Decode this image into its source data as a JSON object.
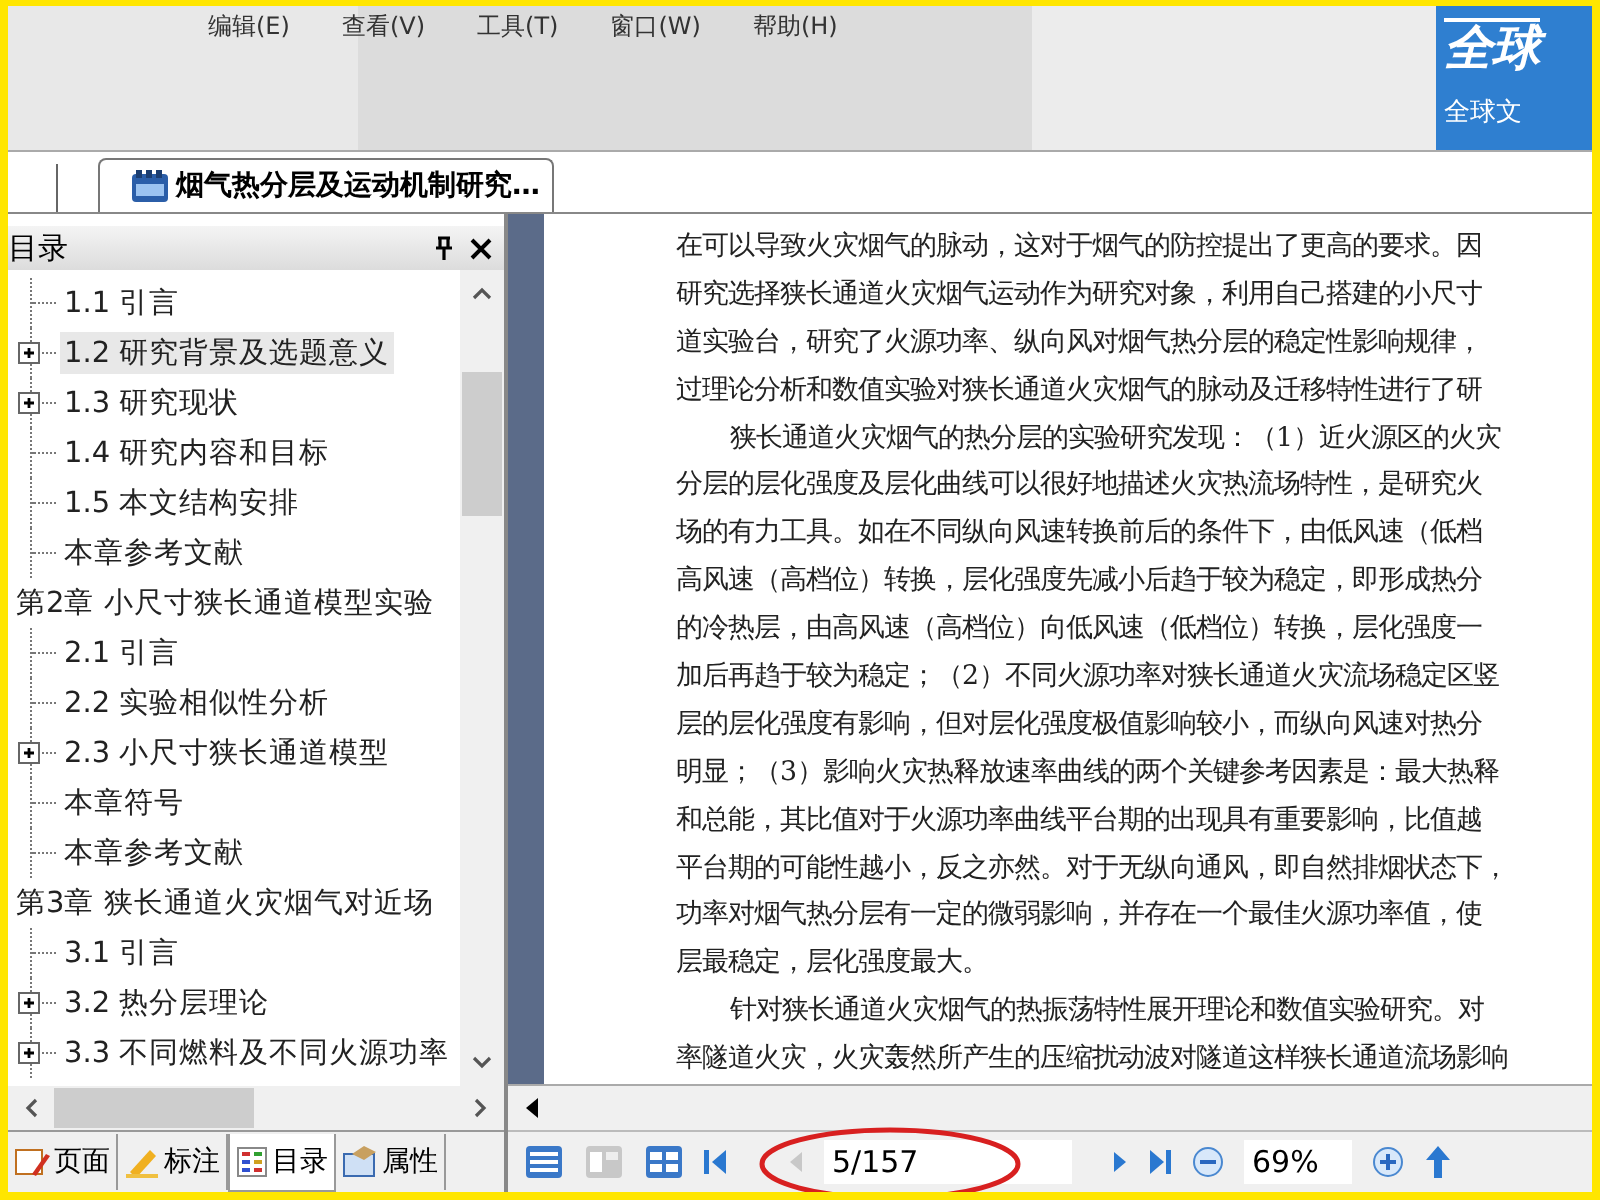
{
  "menu": [
    "编辑(E)",
    "查看(V)",
    "工具(T)",
    "窗口(W)",
    "帮助(H)"
  ],
  "ad": {
    "logo": "全球",
    "caption": "全球文"
  },
  "tabs": [
    {
      "label": "烟气热分层及运动机制研究…",
      "selected": true
    }
  ],
  "toc_panel": {
    "title": "目录",
    "continued_items": [
      {
        "label": "1.1 引言",
        "expandable": false,
        "selected": false
      },
      {
        "label": "1.2 研究背景及选题意义",
        "expandable": true,
        "selected": true
      },
      {
        "label": "1.3 研究现状",
        "expandable": true,
        "selected": false
      },
      {
        "label": "1.4 研究内容和目标",
        "expandable": false,
        "selected": false
      },
      {
        "label": "1.5 本文结构安排",
        "expandable": false,
        "selected": false
      },
      {
        "label": "本章参考文献",
        "expandable": false,
        "selected": false
      }
    ],
    "chapters": [
      {
        "label": "第2章 小尺寸狭长通道模型实验",
        "selected": false,
        "children": [
          {
            "label": "2.1 引言",
            "expandable": false,
            "selected": false
          },
          {
            "label": "2.2 实验相似性分析",
            "expandable": false,
            "selected": false
          },
          {
            "label": "2.3 小尺寸狭长通道模型",
            "expandable": true,
            "selected": false
          },
          {
            "label": "本章符号",
            "expandable": false,
            "selected": false
          },
          {
            "label": "本章参考文献",
            "expandable": false,
            "selected": false
          }
        ]
      },
      {
        "label": "第3章 狭长通道火灾烟气对近场",
        "selected": false,
        "children": [
          {
            "label": "3.1 引言",
            "expandable": false,
            "selected": false
          },
          {
            "label": "3.2 热分层理论",
            "expandable": true,
            "selected": false
          },
          {
            "label": "3.3 不同燃料及不同火源功率",
            "expandable": true,
            "selected": false
          }
        ]
      }
    ]
  },
  "panel_tabs": [
    {
      "label": "页面",
      "kind": "page",
      "selected": false
    },
    {
      "label": "标注",
      "kind": "annotation",
      "selected": false
    },
    {
      "label": "目录",
      "kind": "toc",
      "selected": true
    },
    {
      "label": "属性",
      "kind": "properties",
      "selected": false
    }
  ],
  "document": {
    "lines": [
      {
        "text": "在可以导致火灾烟气的脉动，这对于烟气的防控提出了更高的要求。因",
        "indent": false
      },
      {
        "text": "研究选择狭长通道火灾烟气运动作为研究对象，利用自己搭建的小尺寸",
        "indent": false
      },
      {
        "text": "道实验台，研究了火源功率、纵向风对烟气热分层的稳定性影响规律，",
        "indent": false
      },
      {
        "text": "过理论分析和数值实验对狭长通道火灾烟气的脉动及迁移特性进行了研",
        "indent": false
      },
      {
        "text": "狭长通道火灾烟气的热分层的实验研究发现：（1）近火源区的火灾",
        "indent": true
      },
      {
        "text": "分层的层化强度及层化曲线可以很好地描述火灾热流场特性，是研究火",
        "indent": false
      },
      {
        "text": "场的有力工具。如在不同纵向风速转换前后的条件下，由低风速（低档",
        "indent": false
      },
      {
        "text": "高风速（高档位）转换，层化强度先减小后趋于较为稳定，即形成热分",
        "indent": false
      },
      {
        "text": "的冷热层，由高风速（高档位）向低风速（低档位）转换，层化强度一",
        "indent": false
      },
      {
        "text": "加后再趋于较为稳定；（2）不同火源功率对狭长通道火灾流场稳定区竖",
        "indent": false
      },
      {
        "text": "层的层化强度有影响，但对层化强度极值影响较小，而纵向风速对热分",
        "indent": false
      },
      {
        "text": "明显；（3）影响火灾热释放速率曲线的两个关键参考因素是：最大热释",
        "indent": false
      },
      {
        "text": "和总能，其比值对于火源功率曲线平台期的出现具有重要影响，比值越",
        "indent": false
      },
      {
        "text": "平台期的可能性越小，反之亦然。对于无纵向通风，即自然排烟状态下，",
        "indent": false
      },
      {
        "text": "功率对烟气热分层有一定的微弱影响，并存在一个最佳火源功率值，使",
        "indent": false
      },
      {
        "text": "层最稳定，层化强度最大。",
        "indent": false
      },
      {
        "text": "针对狭长通道火灾烟气的热振荡特性展开理论和数值实验研究。对",
        "indent": true
      },
      {
        "text": "率隧道火灾，火灾轰然所产生的压缩扰动波对隧道这样狭长通道流场影响",
        "indent": false
      }
    ]
  },
  "page_nav": {
    "page": "5/157",
    "zoom": "69%"
  }
}
